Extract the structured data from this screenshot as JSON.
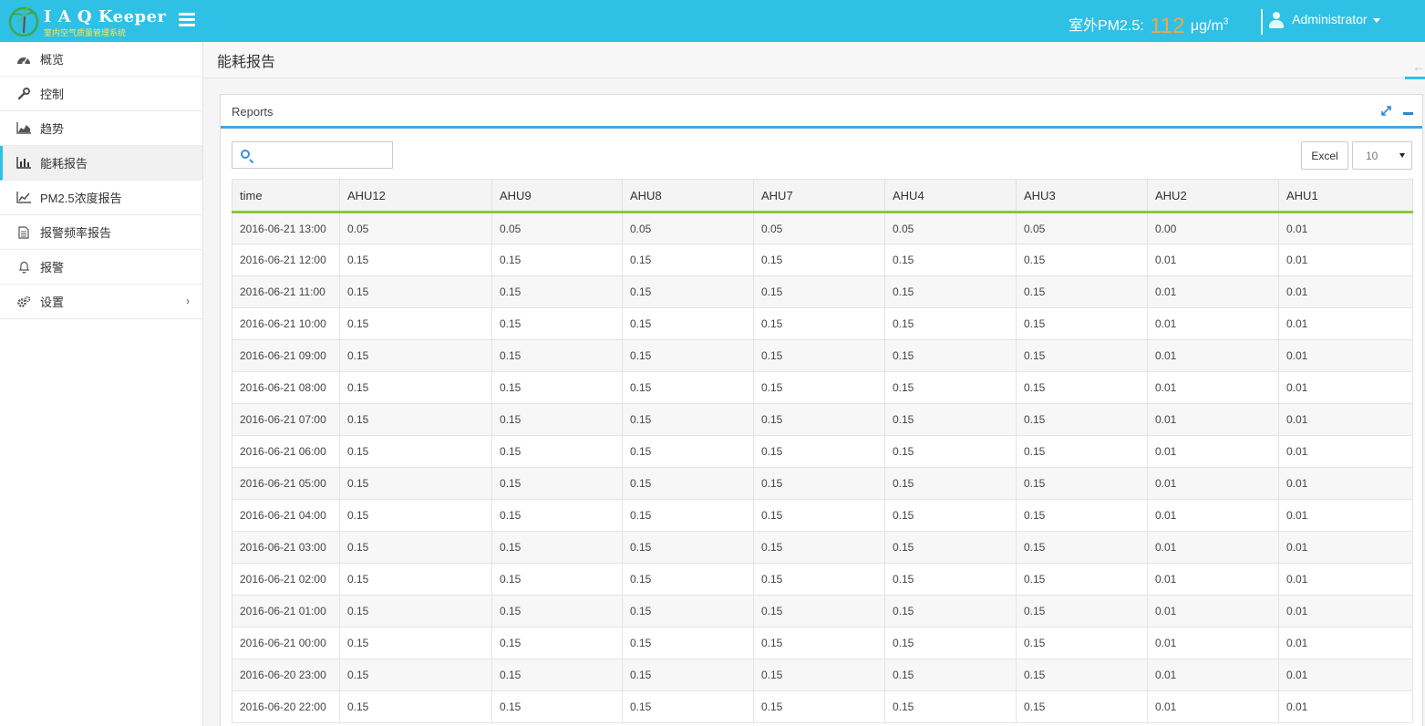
{
  "header": {
    "logo_title": "I A Q Keeper",
    "logo_subtitle": "室内空气质量管理系统",
    "outdoor_label": "室外PM2.5:",
    "outdoor_value": "112",
    "outdoor_unit": "μg/m",
    "outdoor_unit_sup": "3",
    "user_name": "Administrator"
  },
  "sidebar": {
    "items": [
      {
        "label": "概览",
        "icon": "dashboard-icon"
      },
      {
        "label": "控制",
        "icon": "wrench-icon"
      },
      {
        "label": "趋势",
        "icon": "area-chart-icon"
      },
      {
        "label": "能耗报告",
        "icon": "bar-chart-icon"
      },
      {
        "label": "PM2.5浓度报告",
        "icon": "line-chart-icon"
      },
      {
        "label": "报警频率报告",
        "icon": "document-icon"
      },
      {
        "label": "报警",
        "icon": "bell-icon"
      },
      {
        "label": "设置",
        "icon": "gears-icon"
      }
    ],
    "active": "能耗报告"
  },
  "page": {
    "title": "能耗报告"
  },
  "panel": {
    "title": "Reports",
    "search_placeholder": "",
    "excel_label": "Excel",
    "page_size": "10"
  },
  "table": {
    "columns": [
      "time",
      "AHU12",
      "AHU9",
      "AHU8",
      "AHU7",
      "AHU4",
      "AHU3",
      "AHU2",
      "AHU1"
    ],
    "rows": [
      [
        "2016-06-21 13:00",
        "0.05",
        "0.05",
        "0.05",
        "0.05",
        "0.05",
        "0.05",
        "0.00",
        "0.01"
      ],
      [
        "2016-06-21 12:00",
        "0.15",
        "0.15",
        "0.15",
        "0.15",
        "0.15",
        "0.15",
        "0.01",
        "0.01"
      ],
      [
        "2016-06-21 11:00",
        "0.15",
        "0.15",
        "0.15",
        "0.15",
        "0.15",
        "0.15",
        "0.01",
        "0.01"
      ],
      [
        "2016-06-21 10:00",
        "0.15",
        "0.15",
        "0.15",
        "0.15",
        "0.15",
        "0.15",
        "0.01",
        "0.01"
      ],
      [
        "2016-06-21 09:00",
        "0.15",
        "0.15",
        "0.15",
        "0.15",
        "0.15",
        "0.15",
        "0.01",
        "0.01"
      ],
      [
        "2016-06-21 08:00",
        "0.15",
        "0.15",
        "0.15",
        "0.15",
        "0.15",
        "0.15",
        "0.01",
        "0.01"
      ],
      [
        "2016-06-21 07:00",
        "0.15",
        "0.15",
        "0.15",
        "0.15",
        "0.15",
        "0.15",
        "0.01",
        "0.01"
      ],
      [
        "2016-06-21 06:00",
        "0.15",
        "0.15",
        "0.15",
        "0.15",
        "0.15",
        "0.15",
        "0.01",
        "0.01"
      ],
      [
        "2016-06-21 05:00",
        "0.15",
        "0.15",
        "0.15",
        "0.15",
        "0.15",
        "0.15",
        "0.01",
        "0.01"
      ],
      [
        "2016-06-21 04:00",
        "0.15",
        "0.15",
        "0.15",
        "0.15",
        "0.15",
        "0.15",
        "0.01",
        "0.01"
      ],
      [
        "2016-06-21 03:00",
        "0.15",
        "0.15",
        "0.15",
        "0.15",
        "0.15",
        "0.15",
        "0.01",
        "0.01"
      ],
      [
        "2016-06-21 02:00",
        "0.15",
        "0.15",
        "0.15",
        "0.15",
        "0.15",
        "0.15",
        "0.01",
        "0.01"
      ],
      [
        "2016-06-21 01:00",
        "0.15",
        "0.15",
        "0.15",
        "0.15",
        "0.15",
        "0.15",
        "0.01",
        "0.01"
      ],
      [
        "2016-06-21 00:00",
        "0.15",
        "0.15",
        "0.15",
        "0.15",
        "0.15",
        "0.15",
        "0.01",
        "0.01"
      ],
      [
        "2016-06-20 23:00",
        "0.15",
        "0.15",
        "0.15",
        "0.15",
        "0.15",
        "0.15",
        "0.01",
        "0.01"
      ],
      [
        "2016-06-20 22:00",
        "0.15",
        "0.15",
        "0.15",
        "0.15",
        "0.15",
        "0.15",
        "0.01",
        "0.01"
      ]
    ]
  },
  "colors": {
    "topbar": "#2fc0e6",
    "pm_value": "#f0a64a",
    "header_underline": "#8cc63f",
    "panel_accent": "#4aa3df"
  }
}
